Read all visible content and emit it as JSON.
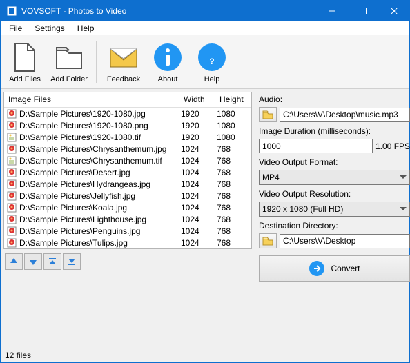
{
  "window": {
    "title": "VOVSOFT - Photos to Video"
  },
  "menu": {
    "file": "File",
    "settings": "Settings",
    "help": "Help"
  },
  "toolbar": {
    "add_files": "Add Files",
    "add_folder": "Add Folder",
    "feedback": "Feedback",
    "about": "About",
    "help": "Help"
  },
  "list": {
    "header_files": "Image Files",
    "header_width": "Width",
    "header_height": "Height",
    "rows": [
      {
        "path": "D:\\Sample Pictures\\1920-1080.jpg",
        "w": "1920",
        "h": "1080",
        "type": "jpg"
      },
      {
        "path": "D:\\Sample Pictures\\1920-1080.png",
        "w": "1920",
        "h": "1080",
        "type": "jpg"
      },
      {
        "path": "D:\\Sample Pictures\\1920-1080.tif",
        "w": "1920",
        "h": "1080",
        "type": "tif"
      },
      {
        "path": "D:\\Sample Pictures\\Chrysanthemum.jpg",
        "w": "1024",
        "h": "768",
        "type": "jpg"
      },
      {
        "path": "D:\\Sample Pictures\\Chrysanthemum.tif",
        "w": "1024",
        "h": "768",
        "type": "tif"
      },
      {
        "path": "D:\\Sample Pictures\\Desert.jpg",
        "w": "1024",
        "h": "768",
        "type": "jpg"
      },
      {
        "path": "D:\\Sample Pictures\\Hydrangeas.jpg",
        "w": "1024",
        "h": "768",
        "type": "jpg"
      },
      {
        "path": "D:\\Sample Pictures\\Jellyfish.jpg",
        "w": "1024",
        "h": "768",
        "type": "jpg"
      },
      {
        "path": "D:\\Sample Pictures\\Koala.jpg",
        "w": "1024",
        "h": "768",
        "type": "jpg"
      },
      {
        "path": "D:\\Sample Pictures\\Lighthouse.jpg",
        "w": "1024",
        "h": "768",
        "type": "jpg"
      },
      {
        "path": "D:\\Sample Pictures\\Penguins.jpg",
        "w": "1024",
        "h": "768",
        "type": "jpg"
      },
      {
        "path": "D:\\Sample Pictures\\Tulips.jpg",
        "w": "1024",
        "h": "768",
        "type": "jpg"
      }
    ]
  },
  "status": {
    "count": "12 files"
  },
  "right": {
    "audio_label": "Audio:",
    "audio_value": "C:\\Users\\V\\Desktop\\music.mp3",
    "duration_label": "Image Duration (milliseconds):",
    "duration_value": "1000",
    "fps_text": "1.00 FPS",
    "format_label": "Video Output Format:",
    "format_value": "MP4",
    "resolution_label": "Video Output Resolution:",
    "resolution_value": "1920 x 1080 (Full HD)",
    "dest_label": "Destination Directory:",
    "dest_value": "C:\\Users\\V\\Desktop",
    "convert": "Convert"
  }
}
